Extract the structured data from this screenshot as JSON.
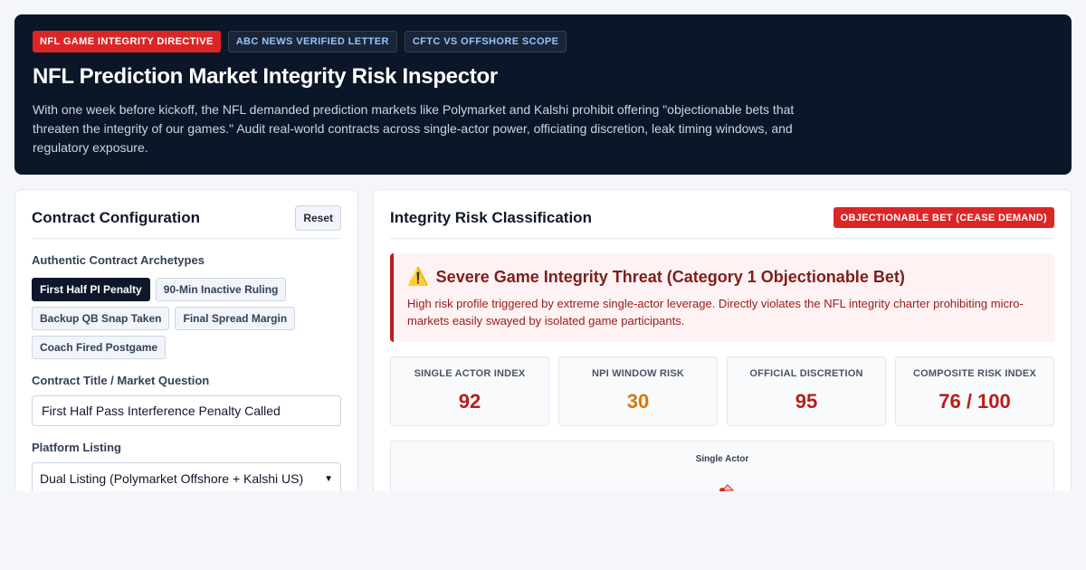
{
  "hero": {
    "tags": [
      "NFL GAME INTEGRITY DIRECTIVE",
      "ABC NEWS VERIFIED LETTER",
      "CFTC VS OFFSHORE SCOPE"
    ],
    "title": "NFL Prediction Market Integrity Risk Inspector",
    "description": "With one week before kickoff, the NFL demanded prediction markets like Polymarket and Kalshi prohibit offering \"objectionable bets that threaten the integrity of our games.\" Audit real-world contracts across single-actor power, officiating discretion, leak timing windows, and regulatory exposure."
  },
  "config": {
    "heading": "Contract Configuration",
    "reset_label": "Reset",
    "archetypes_label": "Authentic Contract Archetypes",
    "archetypes": [
      {
        "label": "First Half PI Penalty",
        "active": true
      },
      {
        "label": "90-Min Inactive Ruling",
        "active": false
      },
      {
        "label": "Backup QB Snap Taken",
        "active": false
      },
      {
        "label": "Final Spread Margin",
        "active": false
      },
      {
        "label": "Coach Fired Postgame",
        "active": false
      }
    ],
    "title_label": "Contract Title / Market Question",
    "title_value": "First Half Pass Interference Penalty Called",
    "platform_label": "Platform Listing",
    "platform_value": "Dual Listing (Polymarket Offshore + Kalshi US)"
  },
  "classification": {
    "heading": "Integrity Risk Classification",
    "badge": "OBJECTIONABLE BET (CEASE DEMAND)",
    "alert_title": "Severe Game Integrity Threat (Category 1 Objectionable Bet)",
    "alert_body": "High risk profile triggered by extreme single-actor leverage. Directly violates the NFL integrity charter prohibiting micro-markets easily swayed by isolated game participants.",
    "metrics": [
      {
        "label": "SINGLE ACTOR INDEX",
        "value": "92",
        "tone": "red"
      },
      {
        "label": "NPI WINDOW RISK",
        "value": "30",
        "tone": "amber"
      },
      {
        "label": "OFFICIAL DISCRETION",
        "value": "95",
        "tone": "red"
      },
      {
        "label": "COMPOSITE RISK INDEX",
        "value": "76 / 100",
        "tone": "red"
      }
    ],
    "radar_axis_top": "Single Actor",
    "colors": {
      "danger": "#dc2626",
      "amber": "#d97706",
      "navy": "#0b1628"
    }
  }
}
